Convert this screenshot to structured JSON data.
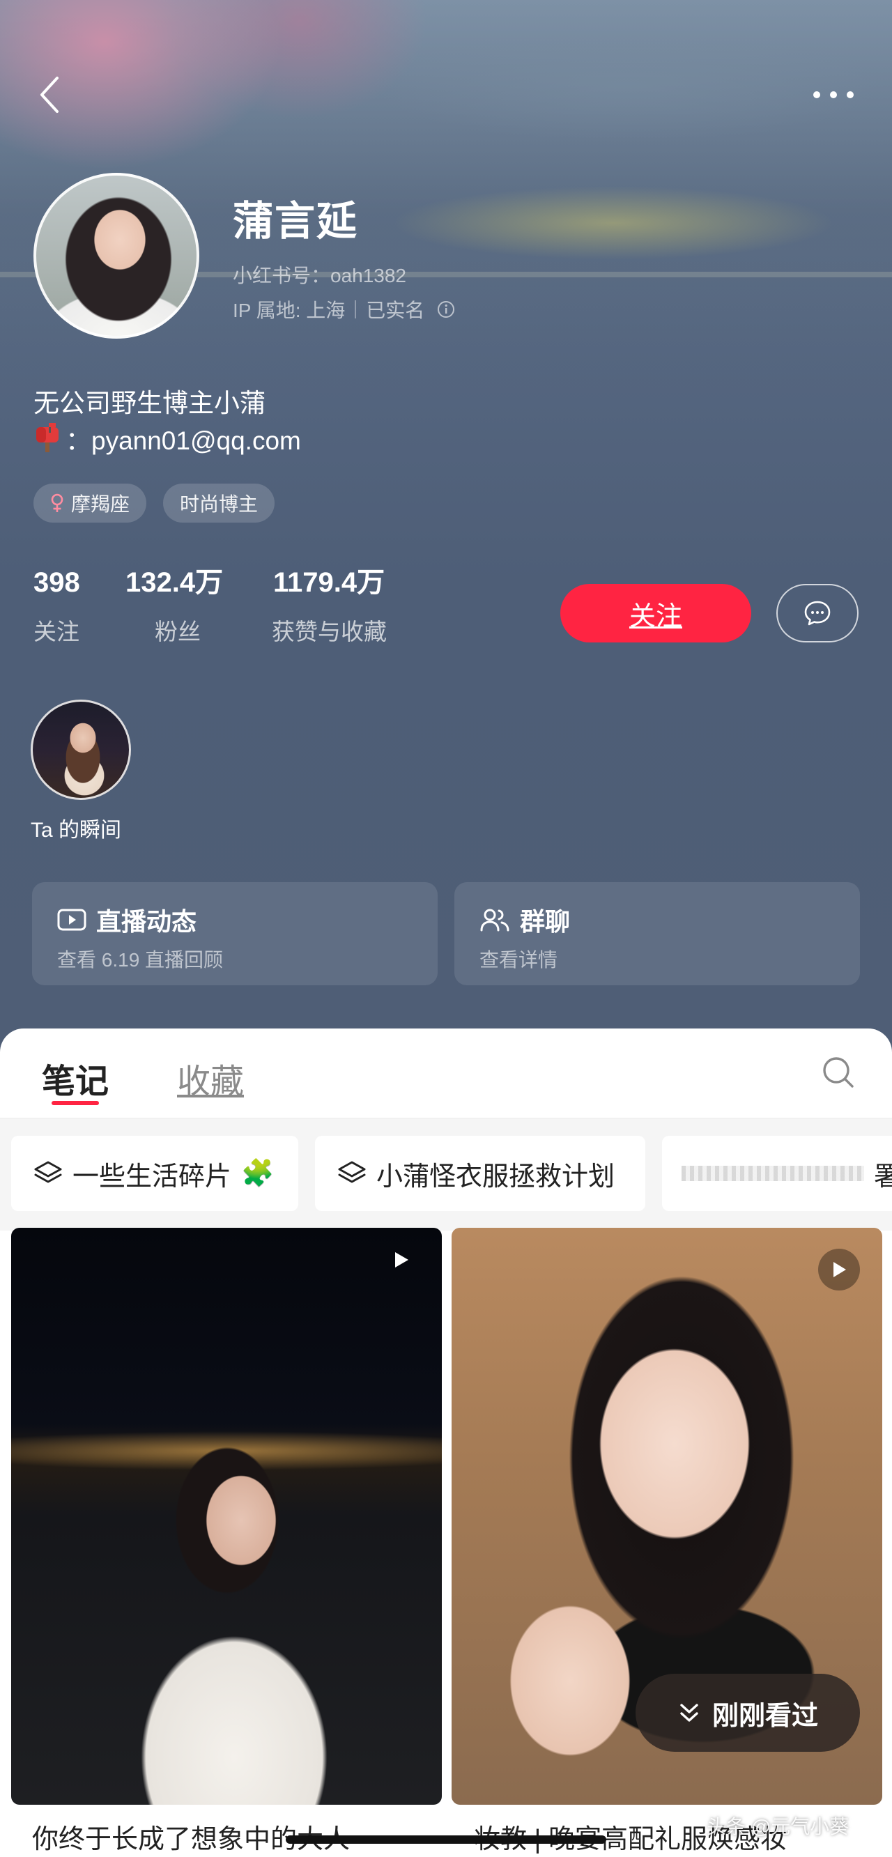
{
  "profile": {
    "name": "蒲言延",
    "red_id": "小红书号：oah1382",
    "ip_location": "IP 属地: 上海",
    "verified": "已实名",
    "bio": "无公司野生博主小蒲",
    "contact_email": "：pyann01@qq.com",
    "tags": [
      {
        "icon": "female-icon",
        "label": "摩羯座"
      },
      {
        "label": "时尚博主"
      }
    ]
  },
  "stats": [
    {
      "value": "398",
      "label": "关注"
    },
    {
      "value": "132.4万",
      "label": "粉丝"
    },
    {
      "value": "1179.4万",
      "label": "获赞与收藏"
    }
  ],
  "actions": {
    "follow_label": "关注"
  },
  "moments": {
    "label": "Ta 的瞬间"
  },
  "features": [
    {
      "icon": "live-video-icon",
      "title": "直播动态",
      "subtitle": "查看 6.19 直播回顾"
    },
    {
      "icon": "group-users-icon",
      "title": "群聊",
      "subtitle": "查看详情"
    }
  ],
  "tabs": [
    {
      "label": "笔记",
      "active": true
    },
    {
      "label": "收藏",
      "active": false
    }
  ],
  "collections": [
    {
      "icon": "layers-icon",
      "label": "一些生活碎片",
      "emoji": "🧩"
    },
    {
      "icon": "layers-icon",
      "label": "小蒲怪衣服拯救计划"
    },
    {
      "label": "署"
    }
  ],
  "notes": [
    {
      "title": "你终于长成了想象中的大人",
      "type": "video"
    },
    {
      "title": "妆教 | 晚宴高配礼服焕感妆",
      "type": "video"
    }
  ],
  "recent_button_label": "刚刚看过",
  "watermark": "头条 @元气小葵",
  "colors": {
    "accent": "#ff2442",
    "header_bg": "#4f5e76"
  }
}
